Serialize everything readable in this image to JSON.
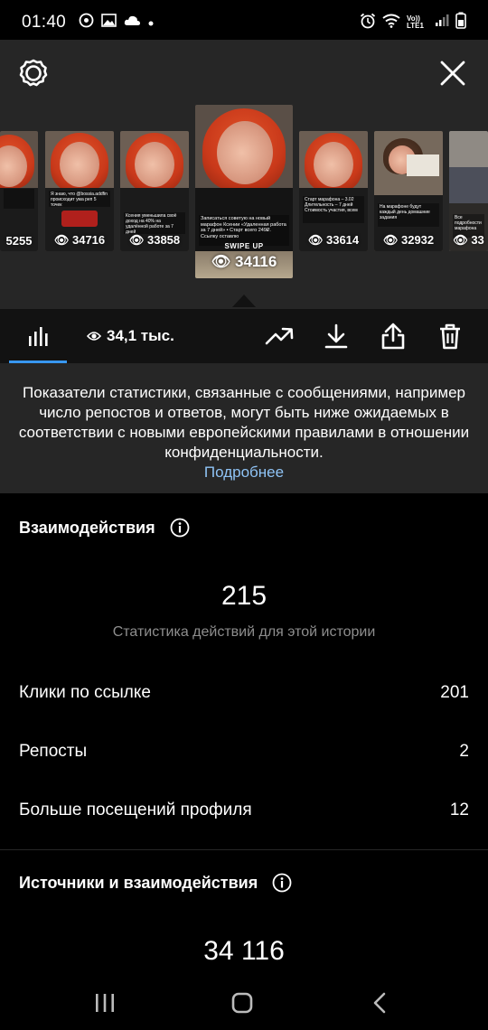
{
  "status_bar": {
    "time": "01:40",
    "network_label": "Vo)) LTE1"
  },
  "top_panel": {
    "thumbnails": [
      {
        "views": "5255"
      },
      {
        "views": "34716",
        "caption": "Я знаю, что @bossia.addfin происходит ума реп 5 точек"
      },
      {
        "views": "33858",
        "caption": "Ксения уменьшила своё доход на 40% на удалённой работе за 7 дней"
      },
      {
        "views": "34116",
        "caption": "Записаться советую на новый марафон Ксении «Удаленная работа за 7 дней» • Старт всего 249₽. Ссылку оставлю",
        "swipe": "SWIPE UP"
      },
      {
        "views": "33614",
        "caption": "Старт марафона – 3.02 Длительность – 7 дней Стоимость участия, всем"
      },
      {
        "views": "32932",
        "caption": "На марафоне будут каждый день домашние задания"
      },
      {
        "views": "33",
        "caption": "Все подробности марафона"
      }
    ]
  },
  "toolbar": {
    "views_count": "34,1 тыс."
  },
  "notice": {
    "text": "Показатели статистики, связанные с сообщениями, например число репостов и ответов, могут быть ниже ожидаемых в соответствии с новыми европейскими правилами в отношении конфиденциальности.",
    "link": "Подробнее"
  },
  "interactions": {
    "title": "Взаимодействия",
    "total": "215",
    "subtitle": "Статистика действий для этой истории",
    "rows": [
      {
        "label": "Клики по ссылке",
        "value": "201"
      },
      {
        "label": "Репосты",
        "value": "2"
      },
      {
        "label": "Больше посещений профиля",
        "value": "12"
      }
    ]
  },
  "sources": {
    "title": "Источники и взаимодействия",
    "total": "34 116"
  },
  "colors": {
    "accent": "#3897f0",
    "link": "#8fc3f5",
    "panel": "#262626",
    "toolbar": "#121212",
    "secondary_text": "#8e8e8e"
  }
}
